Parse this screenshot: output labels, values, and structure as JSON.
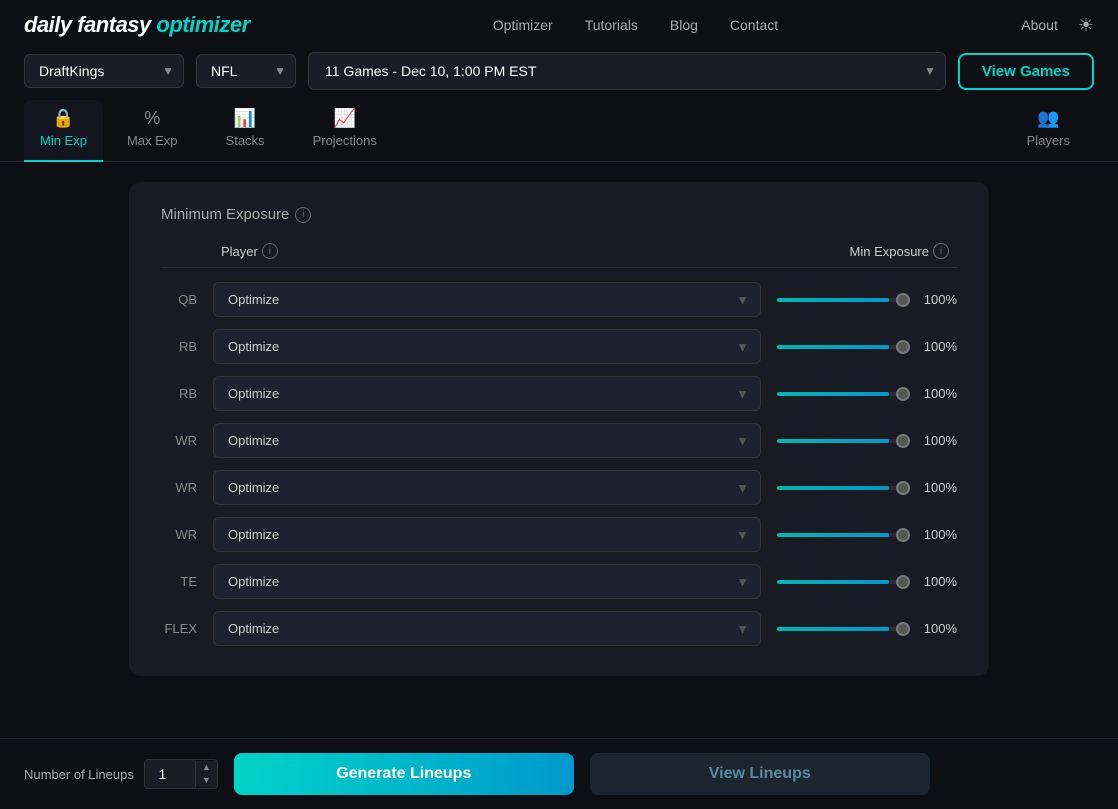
{
  "logo": {
    "daily": "daily ",
    "fantasy": "fantasy ",
    "optimizer": "optimizer"
  },
  "nav": {
    "items": [
      {
        "id": "optimizer",
        "label": "Optimizer"
      },
      {
        "id": "tutorials",
        "label": "Tutorials"
      },
      {
        "id": "blog",
        "label": "Blog"
      },
      {
        "id": "contact",
        "label": "Contact"
      }
    ],
    "about": "About"
  },
  "controls": {
    "site_placeholder": "DraftKings",
    "sport_placeholder": "NFL",
    "game_selection": "11 Games - Dec 10, 1:00 PM EST",
    "view_games_label": "View Games"
  },
  "tabs": [
    {
      "id": "min-exp",
      "label": "Min Exp",
      "icon": "🔒",
      "active": true
    },
    {
      "id": "max-exp",
      "label": "Max Exp",
      "icon": "%"
    },
    {
      "id": "stacks",
      "label": "Stacks",
      "icon": "📊"
    },
    {
      "id": "projections",
      "label": "Projections",
      "icon": "📈"
    },
    {
      "id": "players",
      "label": "Players",
      "icon": "👥"
    }
  ],
  "panel": {
    "title": "Minimum Exposure",
    "player_header": "Player",
    "exposure_header": "Min Exposure",
    "rows": [
      {
        "position": "QB",
        "player": "Optimize",
        "exposure": "100%"
      },
      {
        "position": "RB",
        "player": "Optimize",
        "exposure": "100%"
      },
      {
        "position": "RB",
        "player": "Optimize",
        "exposure": "100%"
      },
      {
        "position": "WR",
        "player": "Optimize",
        "exposure": "100%"
      },
      {
        "position": "WR",
        "player": "Optimize",
        "exposure": "100%"
      },
      {
        "position": "WR",
        "player": "Optimize",
        "exposure": "100%"
      },
      {
        "position": "TE",
        "player": "Optimize",
        "exposure": "100%"
      },
      {
        "position": "FLEX",
        "player": "Optimize",
        "exposure": "100%"
      }
    ]
  },
  "bottom": {
    "lineups_label": "Number of Lineups",
    "lineups_value": "1",
    "generate_label": "Generate Lineups",
    "view_lineups_label": "View Lineups"
  }
}
